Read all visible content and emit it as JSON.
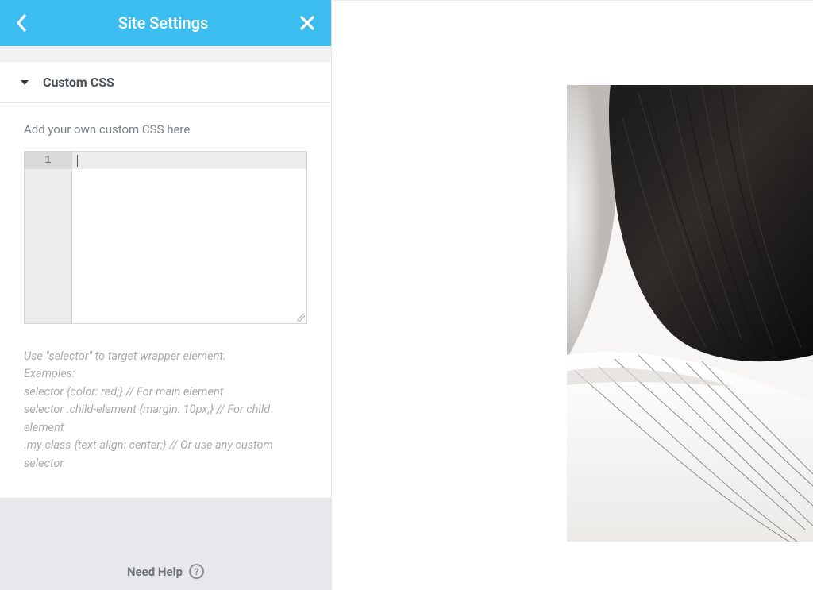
{
  "header": {
    "title": "Site Settings"
  },
  "section": {
    "title": "Custom CSS",
    "label": "Add your own custom CSS here"
  },
  "editor": {
    "line_number": "1",
    "value": ""
  },
  "help_text": {
    "line1": "Use \"selector\" to target wrapper element.",
    "line2": "Examples:",
    "line3": "selector {color: red;} // For main element",
    "line4": "selector .child-element {margin: 10px;} // For child element",
    "line5": ".my-class {text-align: center;} // Or use any custom selector"
  },
  "footer": {
    "help": "Need Help",
    "help_icon": "?"
  }
}
